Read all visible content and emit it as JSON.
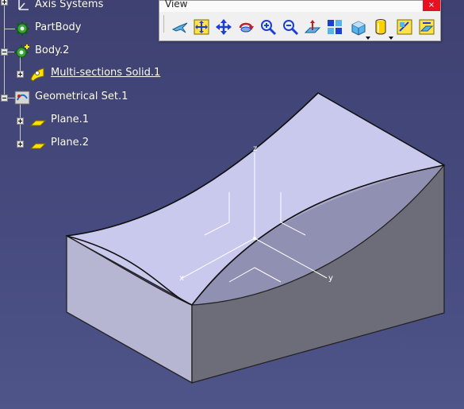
{
  "toolbar": {
    "title": "View",
    "close": "×",
    "buttons": [
      {
        "name": "fly-mode-icon"
      },
      {
        "name": "fit-all-in-icon"
      },
      {
        "name": "pan-icon"
      },
      {
        "name": "rotate-icon"
      },
      {
        "name": "zoom-in-icon"
      },
      {
        "name": "zoom-out-icon"
      },
      {
        "name": "normal-view-icon"
      },
      {
        "name": "multi-view-icon"
      },
      {
        "name": "isometric-view-icon",
        "dropdown": true
      },
      {
        "name": "shading-icon",
        "dropdown": true
      },
      {
        "name": "hide-show-icon"
      },
      {
        "name": "swap-visible-space-icon"
      }
    ]
  },
  "tree": {
    "axis_systems": "Axis Systems",
    "part_body": "PartBody",
    "body2": "Body.2",
    "multi_sections_solid": "Multi-sections Solid.1",
    "geometrical_set": "Geometrical Set.1",
    "plane1": "Plane.1",
    "plane2": "Plane.2"
  },
  "axes": {
    "x": "x",
    "y": "y",
    "z": "z"
  },
  "colors": {
    "background_top": "#3e4171",
    "background_bottom": "#4f5589",
    "solid_top": "#c9c9ee",
    "solid_front": "#b6b6d2",
    "solid_side": "#6d6d7a",
    "saddle_shadow": "#9292b4"
  }
}
